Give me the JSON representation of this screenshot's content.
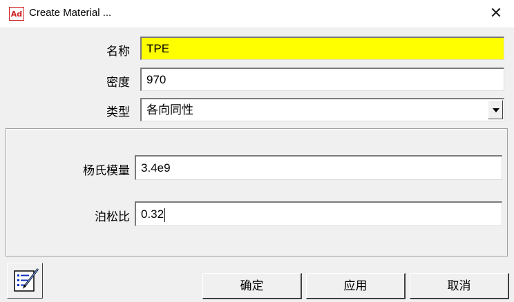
{
  "window": {
    "icon_text": "Ad",
    "title": "Create Material ..."
  },
  "form": {
    "name_label": "名称",
    "name_value": "TPE",
    "density_label": "密度",
    "density_value": "970",
    "type_label": "类型",
    "type_value": "各向同性"
  },
  "properties": {
    "youngs_label": "杨氏模量",
    "youngs_value": "3.4e9",
    "poisson_label": "泊松比",
    "poisson_value": "0.32"
  },
  "buttons": {
    "ok": "确定",
    "apply": "应用",
    "cancel": "取消"
  },
  "icons": {
    "close": "close-icon",
    "toolbox": "edit-list-icon"
  },
  "colors": {
    "highlight_field": "#ffff00",
    "app_icon_red": "#d02020"
  }
}
